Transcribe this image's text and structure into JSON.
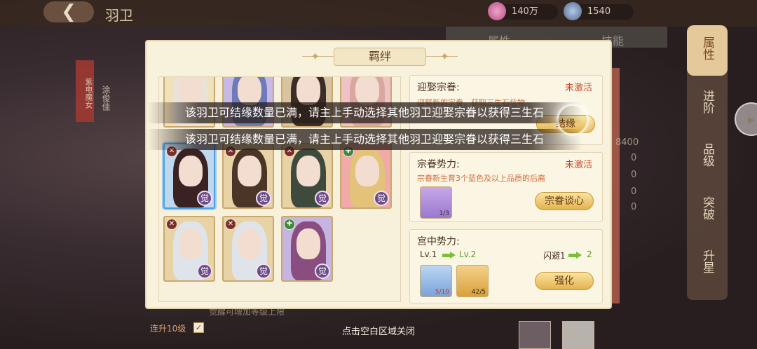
{
  "topbar": {
    "back_icon": "back-arrow-icon",
    "title": "羽卫"
  },
  "resources": [
    {
      "icon": "pink-coin-icon",
      "value": "140万"
    },
    {
      "icon": "blue-gem-icon",
      "value": "1540"
    }
  ],
  "side_tabs": [
    {
      "label": "属性",
      "active": true
    },
    {
      "label": "进阶",
      "active": false
    },
    {
      "label": "品级",
      "active": false
    },
    {
      "label": "突破",
      "active": false
    },
    {
      "label": "升星",
      "active": false
    }
  ],
  "background": {
    "label_red": "紫电魔女",
    "label_name": "涂俊佳",
    "bottom_text": "觉醒可增加等级上限",
    "lianshen": "连升10级",
    "check": "✓",
    "shadow_tabs": [
      "属性",
      "技能"
    ],
    "stat_value": "8400",
    "zeros": [
      "0",
      "0",
      "0",
      "0"
    ]
  },
  "dialog": {
    "title": "羁绊",
    "cards": [
      {
        "row": 0,
        "col": 0,
        "tint": "#efe1b9",
        "hair": "#e9e2d8",
        "partial": true
      },
      {
        "row": 0,
        "col": 1,
        "tint": "#c8b8e6",
        "hair": "#6d7bb8",
        "partial": true
      },
      {
        "row": 0,
        "col": 2,
        "tint": "#d9c4a2",
        "hair": "#3c2d26",
        "partial": true
      },
      {
        "row": 0,
        "col": 3,
        "tint": "#f0c2c6",
        "hair": "#d9a7a0",
        "partial": true
      },
      {
        "row": 1,
        "col": 0,
        "tint": "#c0d8ee",
        "hair": "#3b2222",
        "badge": "觉",
        "corner": "✕",
        "selected": true
      },
      {
        "row": 1,
        "col": 1,
        "tint": "#e8d3a6",
        "hair": "#4a3527",
        "badge": "觉",
        "corner": "✕"
      },
      {
        "row": 1,
        "col": 2,
        "tint": "#e8d3a6",
        "hair": "#3d4a3c",
        "badge": "觉",
        "corner": "✕"
      },
      {
        "row": 1,
        "col": 3,
        "tint": "#f1aaa8",
        "hair": "#e3c27a",
        "badge": "觉",
        "corner": "✚"
      },
      {
        "row": 2,
        "col": 0,
        "tint": "#e8d3a6",
        "hair": "#dfe4ea",
        "badge": "觉",
        "corner": "✕"
      },
      {
        "row": 2,
        "col": 1,
        "tint": "#e8d3a6",
        "hair": "#dfe4ea",
        "badge": "觉",
        "corner": "✕"
      },
      {
        "row": 2,
        "col": 2,
        "tint": "#c6b4e2",
        "hair": "#8a4d7f",
        "badge": "觉",
        "corner": "✚"
      }
    ],
    "panel1": {
      "title": "迎娶宗眷:",
      "status": "未激活",
      "desc": "迎娶新的宗眷，获取三生石信物",
      "button": "结缘"
    },
    "panel2": {
      "title": "宗眷势力:",
      "status": "未激活",
      "desc": "宗眷新生育3个蓝色及以上品质的后裔",
      "item_count": "1/3",
      "button": "宗眷谈心"
    },
    "panel3": {
      "title": "宫中势力:",
      "lv_from": "Lv.1",
      "lv_to": "Lv.2",
      "dodge_label": "闪避1",
      "dodge_to": "2",
      "item1_count": "5/10",
      "item2_count": "42/5",
      "button": "强化"
    }
  },
  "toasts": [
    "该羽卫可结缘数量已满，请主上手动选择其他羽卫迎娶宗眷以获得三生石",
    "该羽卫可结缘数量已满，请主上手动选择其他羽卫迎娶宗眷以获得三生石"
  ],
  "close_hint": "点击空白区域关闭",
  "colors": {
    "accent_red": "#c54a2c",
    "gold": "#e2b34f",
    "dialog_bg": "#f8f2dc"
  }
}
